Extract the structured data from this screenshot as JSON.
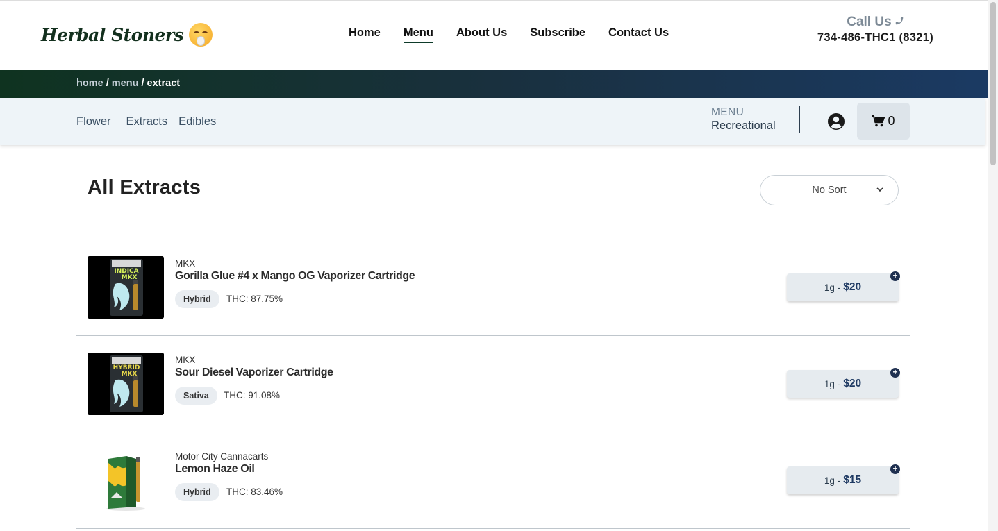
{
  "header": {
    "logo_text": "Herbal Stoners",
    "nav": [
      "Home",
      "Menu",
      "About Us",
      "Subscribe",
      "Contact Us"
    ],
    "active_nav": "Menu",
    "call_label": "Call Us",
    "phone": "734-486-THC1 (8321)"
  },
  "breadcrumb": {
    "home": "home",
    "menu": "menu",
    "current": "extract",
    "separator": "/"
  },
  "subnav": {
    "categories": [
      "Flower",
      "Extracts",
      "Edibles"
    ],
    "menu_label": "MENU",
    "menu_value": "Recreational",
    "cart_count": "0"
  },
  "main": {
    "title": "All Extracts",
    "sort_value": "No Sort"
  },
  "products": [
    {
      "brand": "MKX",
      "name": "Gorilla Glue #4 x Mango OG Vaporizer Cartridge",
      "strain": "Hybrid",
      "thc": "THC: 87.75%",
      "size": "1g",
      "dash": "-",
      "price": "$20",
      "image": "mkx-indica-box"
    },
    {
      "brand": "MKX",
      "name": "Sour Diesel Vaporizer Cartridge",
      "strain": "Sativa",
      "thc": "THC: 91.08%",
      "size": "1g",
      "dash": "-",
      "price": "$20",
      "image": "mkx-hybrid-box"
    },
    {
      "brand": "Motor City Cannacarts",
      "name": "Lemon Haze Oil",
      "strain": "Hybrid",
      "thc": "THC: 83.46%",
      "size": "1g",
      "dash": "-",
      "price": "$15",
      "image": "cannacart-box"
    }
  ],
  "colors": {
    "brand_green": "#13301e",
    "band_start": "#0f3320",
    "band_end": "#1b3a63",
    "price_accent": "#1f3a63"
  }
}
